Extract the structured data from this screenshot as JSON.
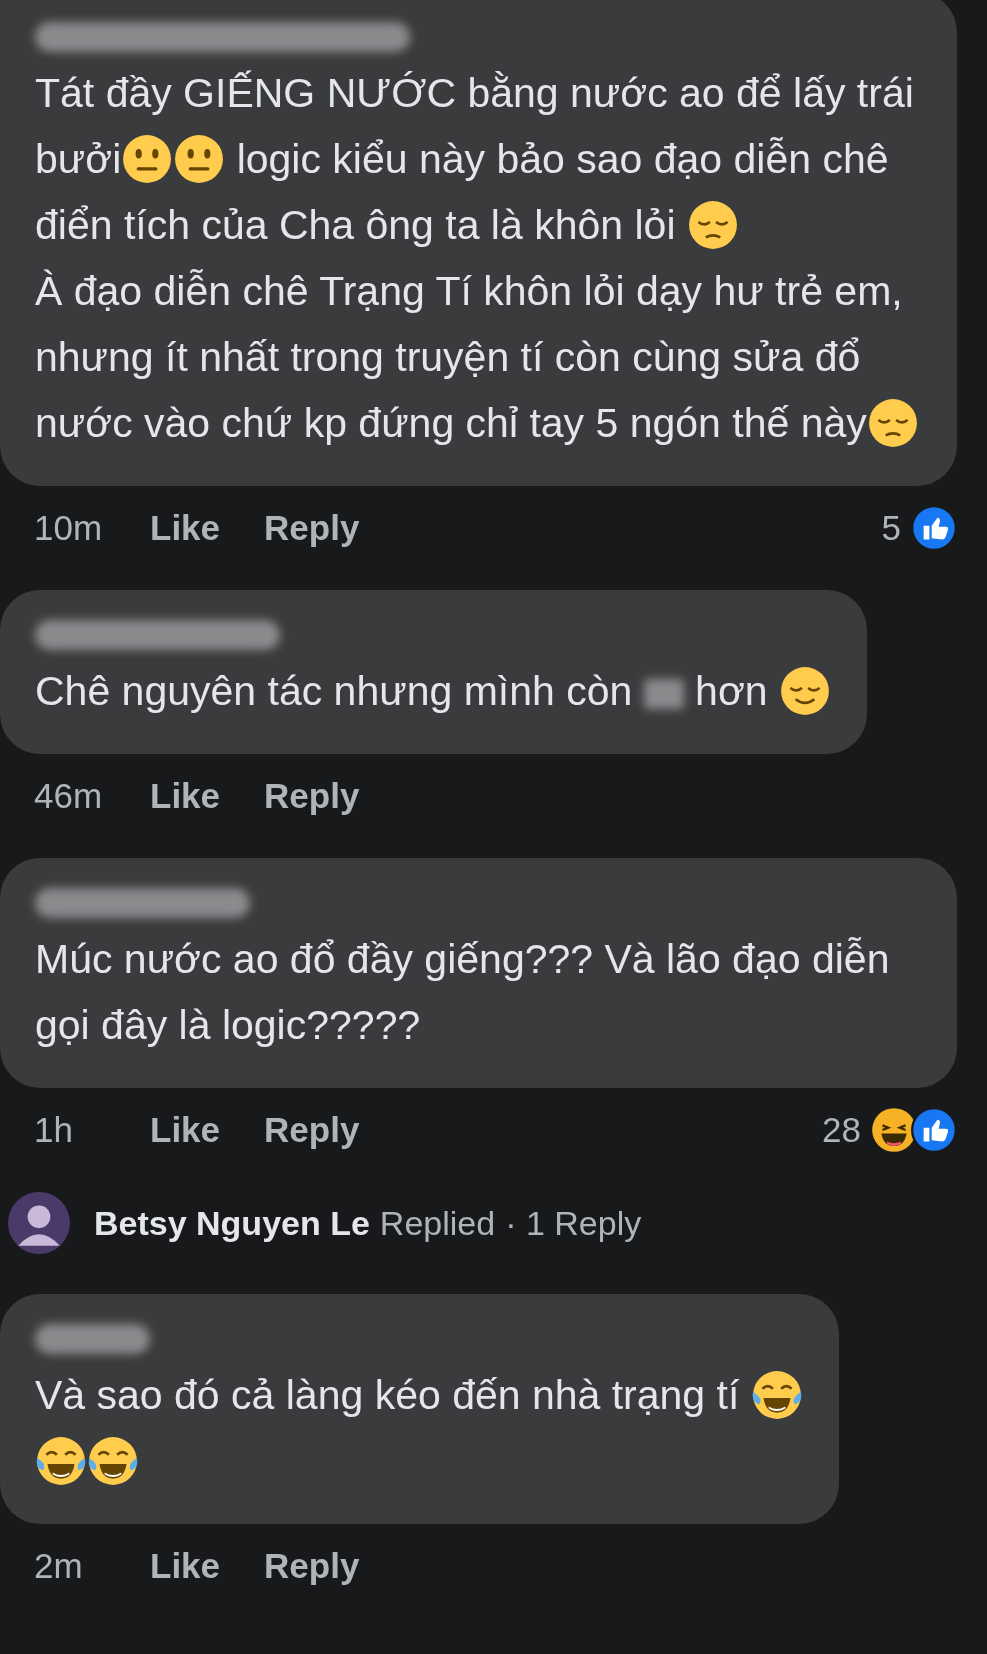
{
  "comments": [
    {
      "author_hidden": true,
      "parts": [
        {
          "kind": "text",
          "text": "Tát đầy GIẾNG NƯỚC bằng nước ao để lấy trái bưởi"
        },
        {
          "kind": "neutral"
        },
        {
          "kind": "neutral"
        },
        {
          "kind": "text",
          "text": " logic kiểu này bảo sao đạo diễn chê điển tích của Cha ông ta là khôn lỏi "
        },
        {
          "kind": "pensive"
        },
        {
          "kind": "break"
        },
        {
          "kind": "text",
          "text": "À đạo diễn chê Trạng Tí khôn lỏi dạy hư trẻ em, nhưng ít nhất trong truyện tí còn cùng sửa đổ nước vào chứ kp đứng chỉ tay 5 ngón thế này"
        },
        {
          "kind": "pensive"
        }
      ],
      "time": "10m",
      "like": "Like",
      "reply": "Reply",
      "reaction_count": "5",
      "reactions": [
        {
          "kind": "like"
        }
      ]
    },
    {
      "author_hidden": true,
      "parts": [
        {
          "kind": "text",
          "text": "Chê nguyên tác nhưng mình còn "
        },
        {
          "kind": "redacted"
        },
        {
          "kind": "text",
          "text": " hơn "
        },
        {
          "kind": "relieved"
        }
      ],
      "time": "46m",
      "like": "Like",
      "reply": "Reply"
    },
    {
      "author_hidden": true,
      "parts": [
        {
          "kind": "text",
          "text": "Múc nước ao đổ đầy giếng??? Và lão đạo diễn gọi đây là logic?????"
        }
      ],
      "time": "1h",
      "like": "Like",
      "reply": "Reply",
      "reaction_count": "28",
      "reactions": [
        {
          "kind": "haha"
        },
        {
          "kind": "like"
        }
      ],
      "replies_summary": {
        "name": "Betsy Nguyen Le",
        "action": "Replied",
        "count": "· 1 Reply"
      }
    },
    {
      "author_hidden": true,
      "parts": [
        {
          "kind": "text",
          "text": "Và sao đó cả làng kéo đến nhà trạng tí "
        },
        {
          "kind": "joy"
        },
        {
          "kind": "break"
        },
        {
          "kind": "joy"
        },
        {
          "kind": "joy"
        }
      ],
      "time": "2m",
      "like": "Like",
      "reply": "Reply"
    }
  ]
}
